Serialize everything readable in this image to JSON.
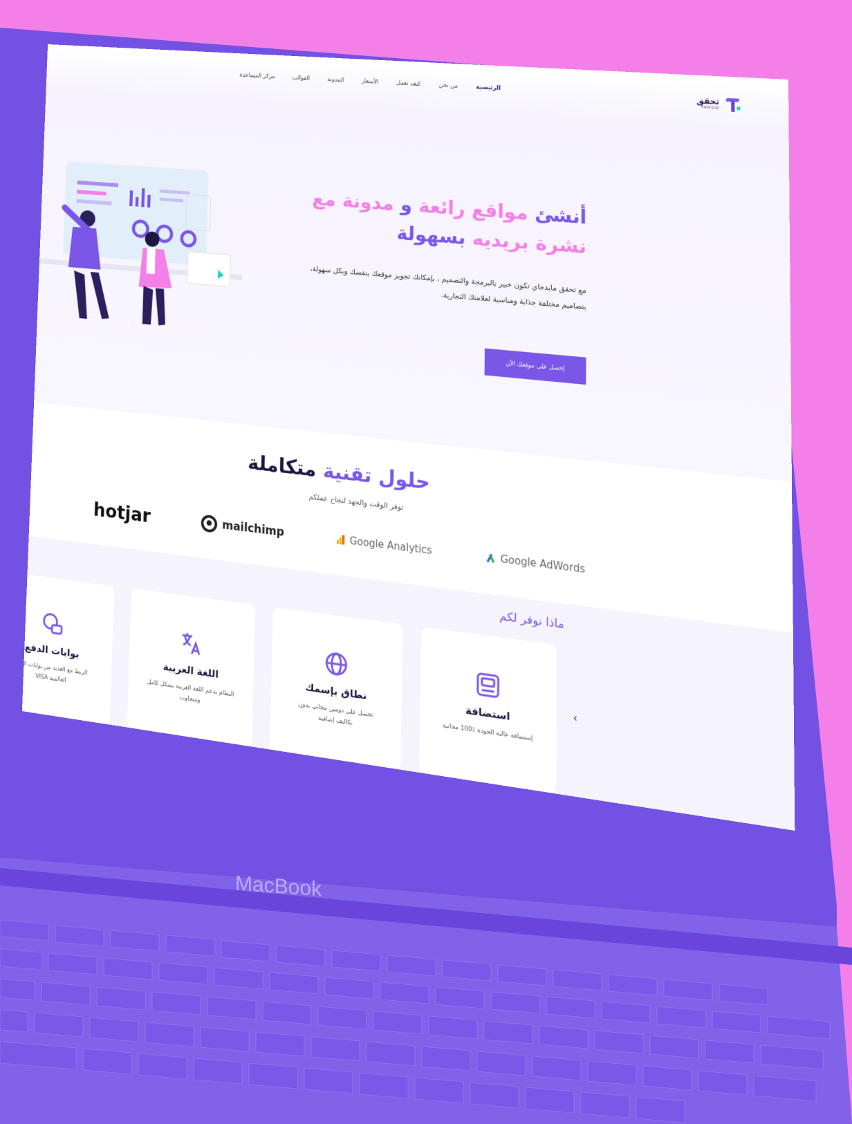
{
  "device": {
    "label": "MacBook"
  },
  "nav": {
    "logo_text": "تحقق",
    "logo_sub": "TAHQQ",
    "links": [
      "الرئيسية",
      "من نحن",
      "كيف تعمل",
      "الأسعار",
      "المدونة",
      "القوالب",
      "مركز المساعدة"
    ]
  },
  "hero": {
    "title_part1": "أنشئ",
    "title_part2": "مواقع رائعة",
    "title_part3": "و",
    "title_part4": "مدونة مع",
    "title_part5": "نشرة بريديه",
    "title_part6": "بسهولة",
    "description": "مع تحقق مايدجاي تكون خبير بالبرمجة والتصميم ، بإمكانك تجويز موقعك بنفسك وبكل سهولة، بتصاميم مختلفة جذابة ومناسبة لعلامتك التجارية.",
    "cta_label": "إحصل على موقعك الآن"
  },
  "integrations": {
    "title_accent": "حلول تقنية",
    "title_rest": "متكاملة",
    "subtitle": "توفر الوقت والجهد لنجاح عملكم",
    "brands": [
      "Google AdWords",
      "Google Analytics",
      "mailchimp",
      "hotjar"
    ]
  },
  "services": {
    "title": "ماذا نوفر لكم",
    "cards": [
      {
        "icon": "hosting-icon",
        "title": "استضافة",
        "desc": "إستضافة عالية الجودة ٪100 مجانية"
      },
      {
        "icon": "globe-icon",
        "title": "نطاق بإسمك",
        "desc": "تحصل على دومين مجاني بدون تكاليف إضافية"
      },
      {
        "icon": "translate-icon",
        "title": "اللغة العربية",
        "desc": "النظام يدعم اللغة العربية بشكل كامل ومتجاوب"
      },
      {
        "icon": "payment-icon",
        "title": "بوابات الدفع",
        "desc": "الربط مع العديد من بوابات الدفع العالمية VISA"
      }
    ],
    "dots_total": 8,
    "dots_active": 7
  },
  "colors": {
    "accent": "#7a57e6",
    "pink": "#f37fe9",
    "dark": "#1d1640"
  }
}
